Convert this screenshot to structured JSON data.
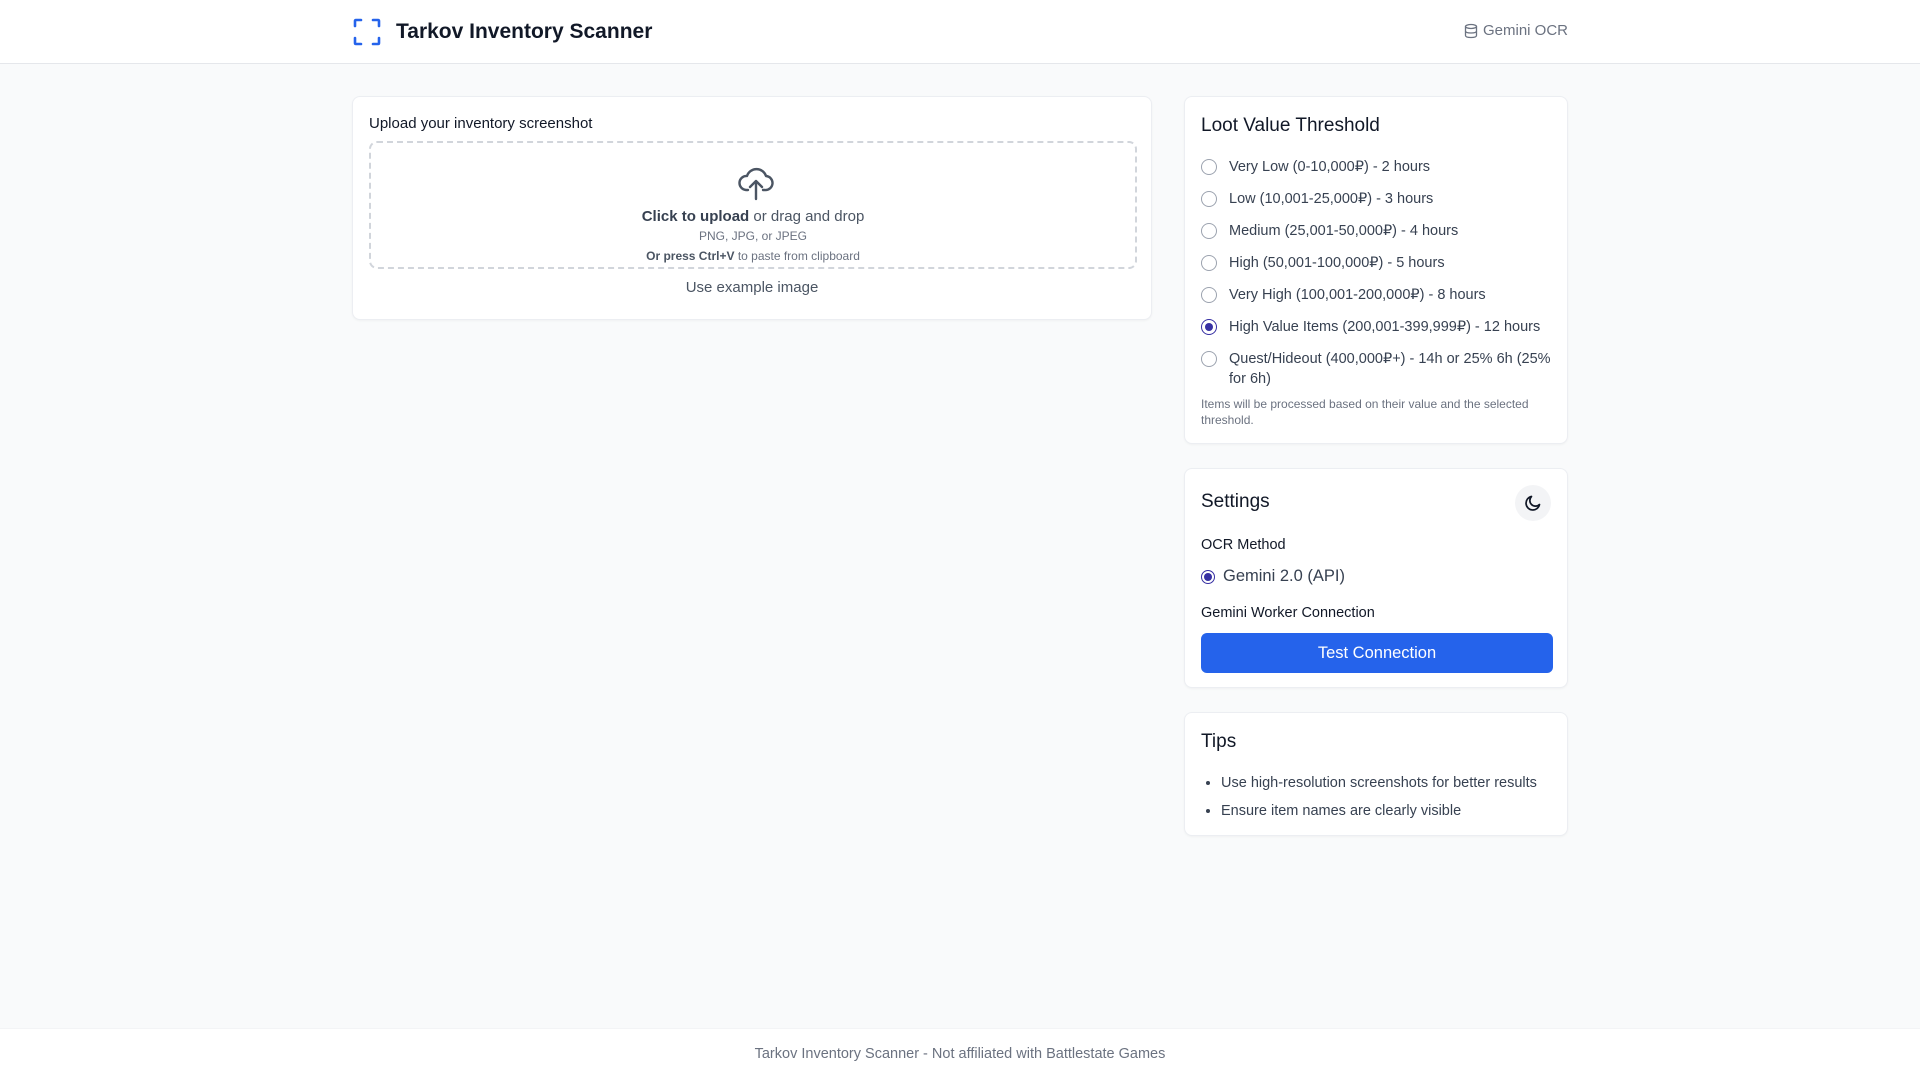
{
  "header": {
    "title": "Tarkov Inventory Scanner",
    "logo_icon": "scan-frame-icon",
    "ocr_badge": "Gemini OCR",
    "ocr_badge_icon": "database-icon",
    "accent_color": "#2563eb"
  },
  "upload": {
    "label": "Upload your inventory screenshot",
    "icon": "cloud-upload-icon",
    "click_text": "Click to upload",
    "drag_text": " or drag and drop",
    "formats": "PNG, JPG, or JPEG",
    "paste_bold": "Or press Ctrl+V",
    "paste_text": " to paste from clipboard",
    "example_link": "Use example image"
  },
  "threshold": {
    "title": "Loot Value Threshold",
    "selected_index": 5,
    "options": [
      "Very Low (0-10,000₽) - 2 hours",
      "Low (10,001-25,000₽) - 3 hours",
      "Medium (25,001-50,000₽) - 4 hours",
      "High (50,001-100,000₽) - 5 hours",
      "Very High (100,001-200,000₽) - 8 hours",
      "High Value Items (200,001-399,999₽) - 12 hours",
      "Quest/Hideout (400,000₽+) - 14h or 25% 6h (25% for 6h)"
    ],
    "note": "Items will be processed based on their value and the selected threshold."
  },
  "settings": {
    "title": "Settings",
    "theme_toggle_icon": "moon-icon",
    "ocr_method_label": "OCR Method",
    "ocr_option": "Gemini 2.0 (API)",
    "worker_label": "Gemini Worker Connection",
    "test_button": "Test Connection"
  },
  "tips": {
    "title": "Tips",
    "items": [
      "Use high-resolution screenshots for better results",
      "Ensure item names are clearly visible"
    ]
  },
  "footer": {
    "text": "Tarkov Inventory Scanner - Not affiliated with Battlestate Games"
  }
}
